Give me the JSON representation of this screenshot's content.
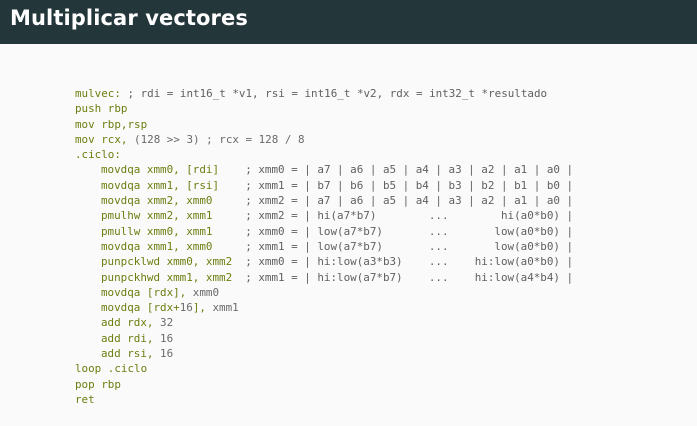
{
  "slide": {
    "title": "Multiplicar vectores"
  },
  "code": {
    "lines": [
      {
        "label": "mulvec:",
        "comment": " ; rdi = int16_t *v1, rsi = int16_t *v2, rdx = int32_t *resultado"
      },
      {
        "instr": "push rbp"
      },
      {
        "instr": "mov rbp,rsp"
      },
      {
        "instr": "mov rcx,",
        "rest": " (128 >> 3) ; rcx = 128 / 8"
      },
      {
        "label": ".ciclo:"
      },
      {
        "instr": "movdqa xmm0, [rdi]",
        "comment": "    ; xmm0 = | a7 | a6 | a5 | a4 | a3 | a2 | a1 | a0 |"
      },
      {
        "instr": "movdqa xmm1, [rsi]",
        "comment": "    ; xmm1 = | b7 | b6 | b5 | b4 | b3 | b2 | b1 | b0 |"
      },
      {
        "instr": "movdqa xmm2, xmm0",
        "comment": "     ; xmm2 = | a7 | a6 | a5 | a4 | a3 | a2 | a1 | a0 |"
      },
      {
        "instr": "pmulhw xmm2, xmm1",
        "comment": "     ; xmm2 = | hi(a7*b7)        ...        hi(a0*b0) |"
      },
      {
        "instr": "pmullw xmm0, xmm1",
        "comment": "     ; xmm0 = | low(a7*b7)       ...       low(a0*b0) |"
      },
      {
        "instr": "movdqa xmm1, xmm0",
        "comment": "     ; xmm1 = | low(a7*b7)       ...       low(a0*b0) |"
      },
      {
        "instr": "punpcklwd xmm0, xmm2",
        "comment": "  ; xmm0 = | hi:low(a3*b3)    ...    hi:low(a0*b0) |"
      },
      {
        "instr": "punpckhwd xmm1, xmm2",
        "comment": "  ; xmm1 = | hi:low(a7*b7)    ...    hi:low(a4*b4) |"
      },
      {
        "instr": "movdqa [rdx],",
        "rest": " xmm0"
      },
      {
        "instr": "movdqa [rdx+",
        "num": "16",
        "instr2": "],",
        "rest": " xmm1"
      },
      {
        "instr": "add rdx,",
        "rest": " 32"
      },
      {
        "instr": "add rdi,",
        "rest": " 16"
      },
      {
        "instr": "add rsi,",
        "rest": " 16"
      },
      {
        "instr": "loop .ciclo"
      },
      {
        "instr": "pop rbp"
      },
      {
        "instr": "ret"
      }
    ]
  },
  "colors": {
    "title_bar": "#23373b",
    "keyword": "#6b7f10",
    "comment": "#606060"
  }
}
